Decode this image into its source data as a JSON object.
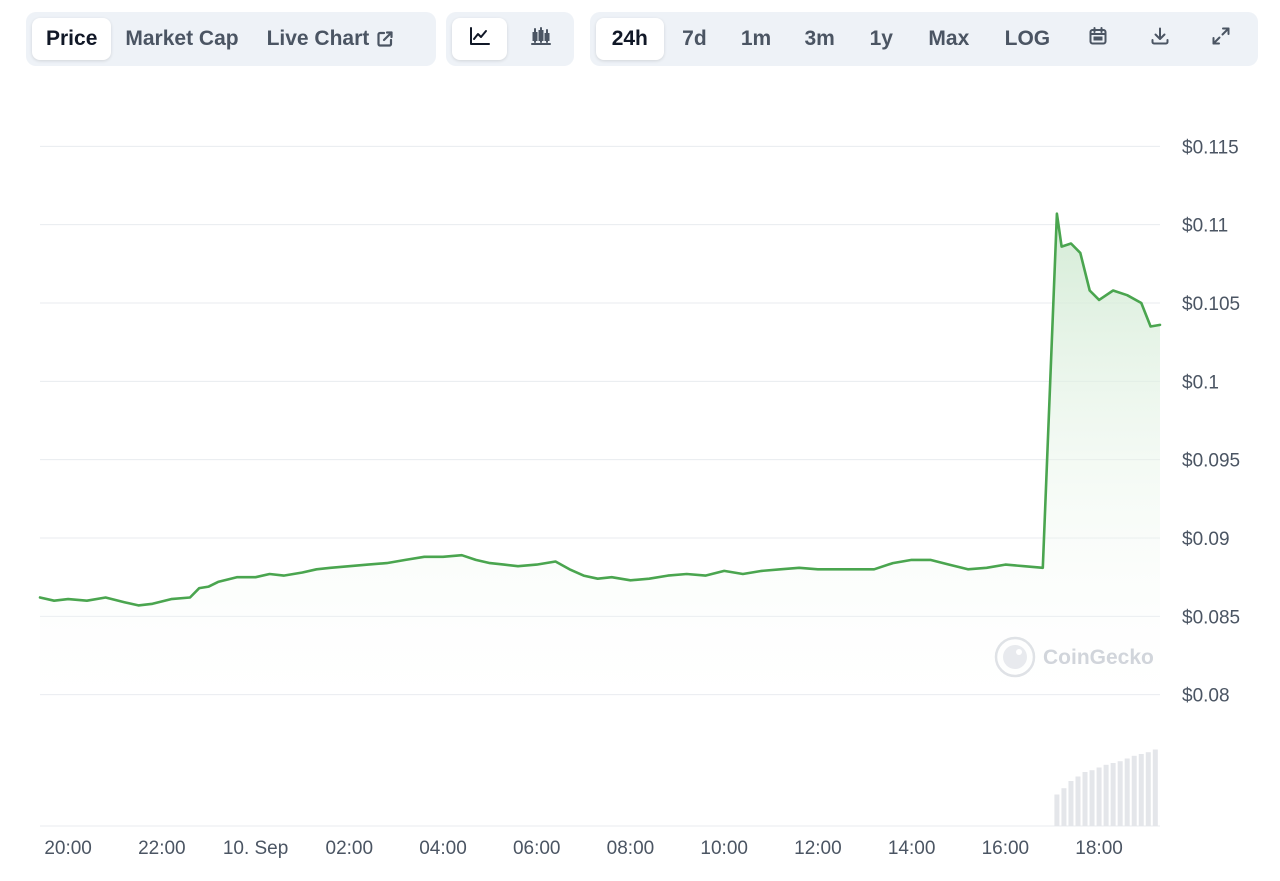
{
  "toolbar": {
    "metric_tabs": [
      {
        "label": "Price",
        "active": true
      },
      {
        "label": "Market Cap",
        "active": false
      },
      {
        "label": "Live Chart",
        "active": false
      }
    ],
    "chart_style_icons": [
      "line-chart-icon",
      "candlestick-chart-icon"
    ],
    "ranges": [
      {
        "label": "24h",
        "active": true
      },
      {
        "label": "7d",
        "active": false
      },
      {
        "label": "1m",
        "active": false
      },
      {
        "label": "3m",
        "active": false
      },
      {
        "label": "1y",
        "active": false
      },
      {
        "label": "Max",
        "active": false
      },
      {
        "label": "LOG",
        "active": false
      }
    ],
    "action_icons": [
      "calendar-icon",
      "download-icon",
      "fullscreen-icon"
    ]
  },
  "watermark": "CoinGecko",
  "colors": {
    "line": "#4aa54f",
    "fill_top": "#cfe9d1",
    "grid": "#e8ebef",
    "volume": "#e4e6ea",
    "toolbar_bg": "#eef2f7"
  },
  "chart_data": {
    "type": "area",
    "title": "",
    "xlabel": "",
    "ylabel": "",
    "ylim": [
      0.078,
      0.117
    ],
    "yticks": [
      0.08,
      0.085,
      0.09,
      0.095,
      0.1,
      0.105,
      0.11,
      0.115
    ],
    "ytick_labels": [
      "$0.08",
      "$0.085",
      "$0.09",
      "$0.095",
      "$0.1",
      "$0.105",
      "$0.11",
      "$0.115"
    ],
    "xlim_hours": [
      19.4,
      43.3
    ],
    "xticks_hours": [
      20,
      22,
      24,
      26,
      28,
      30,
      32,
      34,
      36,
      38,
      40,
      42
    ],
    "xtick_labels": [
      "20:00",
      "22:00",
      "10. Sep",
      "02:00",
      "04:00",
      "06:00",
      "08:00",
      "10:00",
      "12:00",
      "14:00",
      "16:00",
      "18:00"
    ],
    "grid": true,
    "legend": "none",
    "series": [
      {
        "x_hours": [
          19.4,
          19.7,
          20.0,
          20.4,
          20.8,
          21.2,
          21.5,
          21.8,
          22.2,
          22.6,
          22.8,
          23.0,
          23.2,
          23.6,
          24.0,
          24.3,
          24.6,
          25.0,
          25.3,
          25.6,
          26.0,
          26.4,
          26.8,
          27.2,
          27.6,
          28.0,
          28.4,
          28.7,
          29.0,
          29.3,
          29.6,
          30.0,
          30.4,
          30.7,
          31.0,
          31.3,
          31.6,
          32.0,
          32.4,
          32.8,
          33.2,
          33.6,
          34.0,
          34.4,
          34.8,
          35.2,
          35.6,
          36.0,
          36.4,
          36.8,
          37.2,
          37.6,
          38.0,
          38.4,
          38.8,
          39.2,
          39.6,
          40.0,
          40.4,
          40.8,
          41.1,
          41.2,
          41.4,
          41.6,
          41.8,
          42.0,
          42.3,
          42.6,
          42.9,
          43.1,
          43.3
        ],
        "y": [
          0.0862,
          0.086,
          0.0861,
          0.086,
          0.0862,
          0.0859,
          0.0857,
          0.0858,
          0.0861,
          0.0862,
          0.0868,
          0.0869,
          0.0872,
          0.0875,
          0.0875,
          0.0877,
          0.0876,
          0.0878,
          0.088,
          0.0881,
          0.0882,
          0.0883,
          0.0884,
          0.0886,
          0.0888,
          0.0888,
          0.0889,
          0.0886,
          0.0884,
          0.0883,
          0.0882,
          0.0883,
          0.0885,
          0.088,
          0.0876,
          0.0874,
          0.0875,
          0.0873,
          0.0874,
          0.0876,
          0.0877,
          0.0876,
          0.0879,
          0.0877,
          0.0879,
          0.088,
          0.0881,
          0.088,
          0.088,
          0.088,
          0.088,
          0.0884,
          0.0886,
          0.0886,
          0.0883,
          0.088,
          0.0881,
          0.0883,
          0.0882,
          0.0881,
          0.1107,
          0.1086,
          0.1088,
          0.1082,
          0.1058,
          0.1052,
          0.1058,
          0.1055,
          0.105,
          0.1035,
          0.1036
        ]
      }
    ],
    "volume": {
      "x_hours": [
        41.1,
        41.25,
        41.4,
        41.55,
        41.7,
        41.85,
        42.0,
        42.15,
        42.3,
        42.45,
        42.6,
        42.75,
        42.9,
        43.05,
        43.2
      ],
      "relative": [
        0.35,
        0.42,
        0.5,
        0.55,
        0.6,
        0.62,
        0.65,
        0.68,
        0.7,
        0.72,
        0.75,
        0.78,
        0.8,
        0.82,
        0.85
      ]
    }
  }
}
